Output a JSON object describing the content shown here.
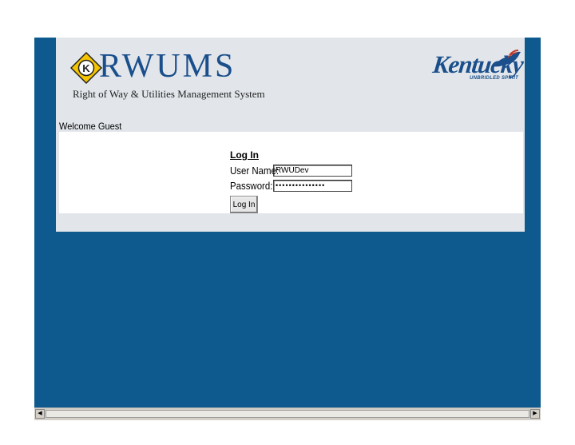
{
  "header": {
    "logo_text": "RWUMS",
    "subtitle": "Right of Way & Utilities Management System",
    "logo_badge_letter": "K",
    "state_logo_word": "Kentucky",
    "state_logo_tagline": "UNBRIDLED SPIRIT"
  },
  "welcome": "Welcome Guest",
  "login": {
    "title": "Log In",
    "username_label": "User Name:",
    "username_value": "RWUDev",
    "password_label": "Password:",
    "password_value": "•••••••••••••••",
    "button_label": "Log In"
  },
  "scrollbar": {
    "left_arrow": "◀",
    "right_arrow": "▶"
  },
  "colors": {
    "background_blue": "#0e5a8e",
    "panel_gray": "#e2e6ea",
    "brand_blue": "#1a4f8c",
    "badge_yellow": "#f5c400"
  },
  "icons": {
    "logo": "yellow-diamond-k-icon",
    "state_logo": "kentucky-horse-logo"
  }
}
